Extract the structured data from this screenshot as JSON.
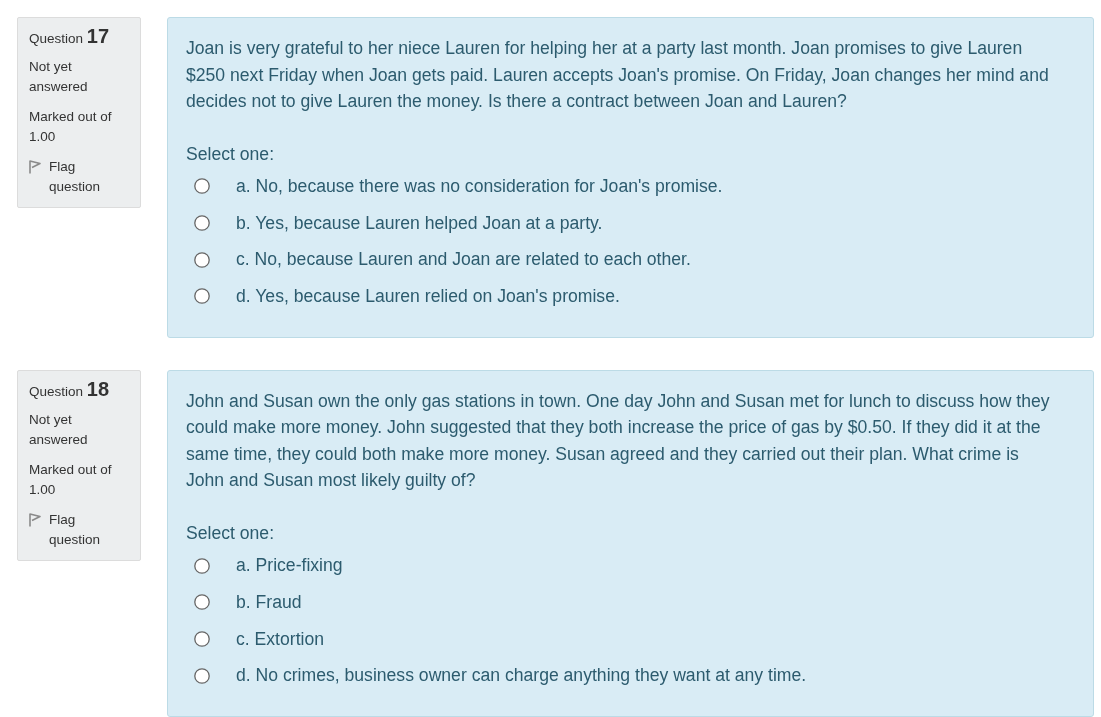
{
  "questions": [
    {
      "number_label": "Question",
      "number": "17",
      "state": "Not yet answered",
      "grade": "Marked out of 1.00",
      "flag": {
        "label": "Flag question",
        "flagged": false
      },
      "text": "Joan is very grateful to her niece Lauren for helping her at a party last month. Joan promises to give Lauren $250 next Friday when Joan gets paid. Lauren accepts Joan's promise. On Friday, Joan changes her mind and decides not to give Lauren the money. Is there a contract between Joan and Lauren?",
      "prompt": "Select one:",
      "options": [
        {
          "label": "a. No, because there was no consideration for Joan's promise.",
          "selected": false
        },
        {
          "label": "b. Yes, because Lauren helped Joan at a party.",
          "selected": false
        },
        {
          "label": "c. No, because Lauren and Joan are related to each other.",
          "selected": false
        },
        {
          "label": "d. Yes, because Lauren relied on Joan's promise.",
          "selected": false
        }
      ]
    },
    {
      "number_label": "Question",
      "number": "18",
      "state": "Not yet answered",
      "grade": "Marked out of 1.00",
      "flag": {
        "label": "Flag question",
        "flagged": false
      },
      "text": "John and Susan own the only gas stations in town. One day John and Susan met for lunch to discuss how they could make more money. John suggested that they both increase the price of gas by $0.50. If they did it at the same time, they could both make more money. Susan agreed and they carried out their plan. What crime is John and Susan most likely guilty of?",
      "prompt": "Select one:",
      "options": [
        {
          "label": "a. Price-fixing",
          "selected": false
        },
        {
          "label": "b. Fraud",
          "selected": false
        },
        {
          "label": "c. Extortion",
          "selected": false
        },
        {
          "label": "d. No crimes, business owner can charge anything they want at any time.",
          "selected": false
        }
      ]
    }
  ]
}
